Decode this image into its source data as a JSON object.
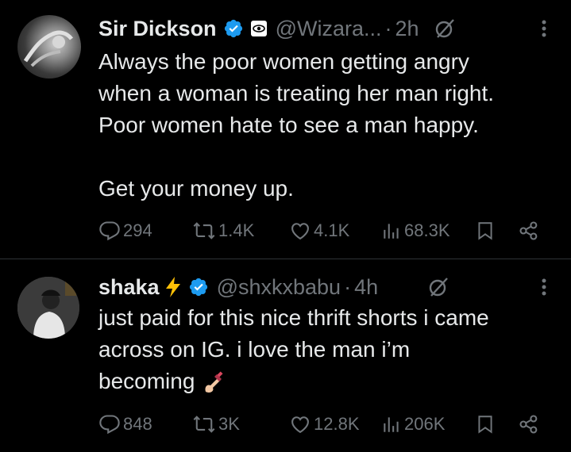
{
  "tweets": [
    {
      "name": "Sir Dickson",
      "handle": "@Wizara...",
      "dot": "·",
      "time": "2h",
      "lines": [
        "Always the poor women getting angry",
        "when a woman is treating her man right.",
        "Poor women hate to see a man happy.",
        "",
        "Get your money up."
      ],
      "replies": "294",
      "reposts": "1.4K",
      "likes": "4.1K",
      "views": "68.3K"
    },
    {
      "name": "shaka",
      "handle": "@shxkxbabu",
      "dot": "·",
      "time": "4h",
      "lines": [
        "just paid for this nice thrift shorts i came",
        "across on IG. i love the man i’m",
        "becoming"
      ],
      "emoji": "nail-polish-emoji",
      "replies": "848",
      "reposts": "3K",
      "likes": "12.8K",
      "views": "206K"
    }
  ],
  "colors": {
    "background": "#000000",
    "text": "#e7e9ea",
    "secondary": "#71767b",
    "verified": "#1d9bf0",
    "divider": "#2f3336",
    "bolt": "#ffc107"
  },
  "icons": [
    "verified-badge-icon",
    "affiliate-badge-icon",
    "grok-icon",
    "more-icon",
    "reply-icon",
    "repost-icon",
    "like-icon",
    "views-icon",
    "bookmark-icon",
    "share-icon",
    "lightning-icon"
  ]
}
